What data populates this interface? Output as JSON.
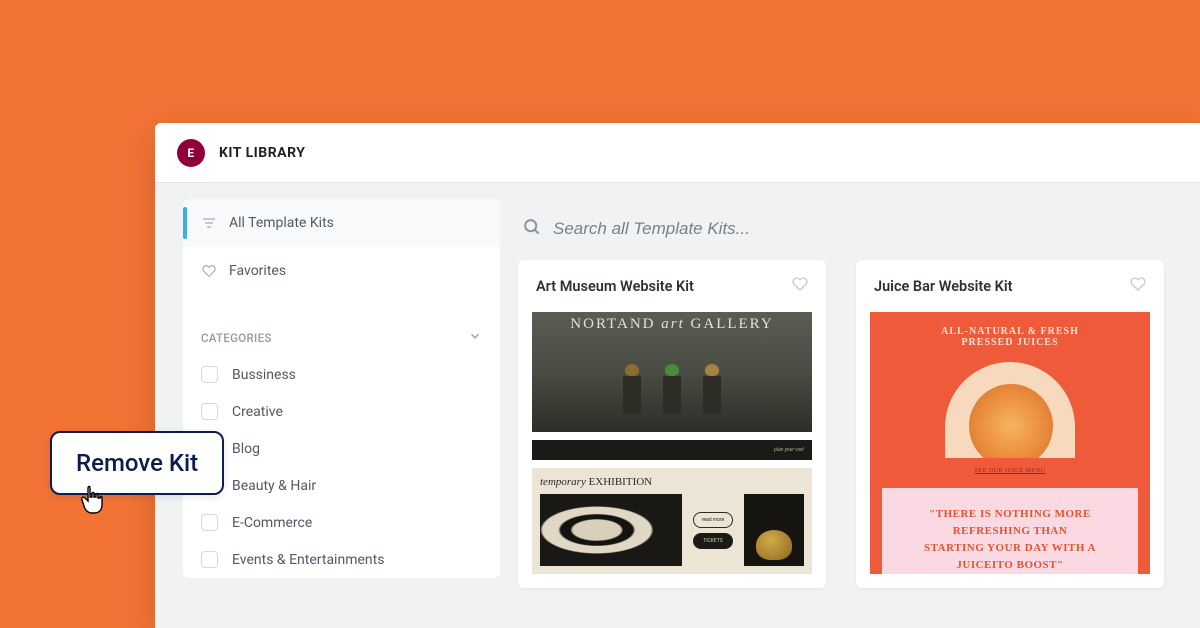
{
  "header": {
    "title": "KIT LIBRARY"
  },
  "sidebar": {
    "tabs": [
      {
        "label": "All Template Kits",
        "active": true
      },
      {
        "label": "Favorites",
        "active": false
      }
    ],
    "section_heading": "CATEGORIES",
    "categories": [
      {
        "label": "Bussiness"
      },
      {
        "label": "Creative"
      },
      {
        "label": "Blog"
      },
      {
        "label": "Beauty & Hair"
      },
      {
        "label": "E-Commerce"
      },
      {
        "label": "Events & Entertainments"
      }
    ]
  },
  "search": {
    "placeholder": "Search all Template Kits..."
  },
  "cards": [
    {
      "title": "Art Museum Website Kit",
      "preview": {
        "hero_title_left": "NORTAND",
        "hero_title_mid": "art",
        "hero_title_right": "GALLERY",
        "strip_right": "plan your visit",
        "exh_title_ital": "temporary",
        "exh_title_caps": " EXHIBITION",
        "pill1": "read more",
        "pill2": "TICKETS"
      }
    },
    {
      "title": "Juice Bar Website Kit",
      "preview": {
        "top_line1": "ALL-NATURAL & FRESH",
        "top_line2": "PRESSED JUICES",
        "small": "SEE OUR JUICE MENU",
        "quote1": "\"THERE IS NOTHING MORE",
        "quote2": "REFRESHING THAN",
        "quote3": "STARTING YOUR DAY WITH A",
        "quote4": "JUICEITO BOOST\""
      }
    }
  ],
  "tooltip": {
    "label": "Remove Kit"
  }
}
